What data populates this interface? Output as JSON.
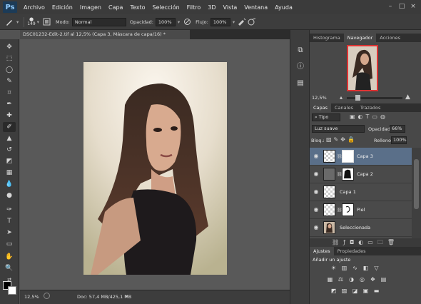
{
  "app": {
    "logo": "Ps"
  },
  "menu": [
    "Archivo",
    "Edición",
    "Imagen",
    "Capa",
    "Texto",
    "Selección",
    "Filtro",
    "3D",
    "Vista",
    "Ventana",
    "Ayuda"
  ],
  "window_controls": [
    "–",
    "□",
    "×"
  ],
  "options": {
    "brush_size": "149",
    "mode_label": "Modo:",
    "mode_value": "Normal",
    "opacity_label": "Opacidad:",
    "opacity_value": "100%",
    "flow_label": "Flujo:",
    "flow_value": "100%"
  },
  "document": {
    "tab_title": "DSC01232-Edit-2.tif al 12,5% (Capa 3, Máscara de capa/16) *",
    "zoom": "12,5%",
    "doc_info": "Doc: 57,4 MB/425,1 MB"
  },
  "navigator": {
    "tabs": [
      "Histograma",
      "Navegador",
      "Acciones"
    ],
    "active_tab": "Navegador",
    "zoom": "12,5%"
  },
  "layers_panel": {
    "tabs": [
      "Capas",
      "Canales",
      "Trazados"
    ],
    "active_tab": "Capas",
    "filter": "Tipo",
    "blend_mode": "Luz suave",
    "opacity_label": "Opacidad:",
    "opacity": "66%",
    "lock_label": "Bloq.:",
    "fill_label": "Relleno:",
    "fill": "100%",
    "layers": [
      {
        "name": "Capa 3",
        "selected": true
      },
      {
        "name": "Capa 2",
        "selected": false
      },
      {
        "name": "Capa 1",
        "selected": false
      },
      {
        "name": "Piel",
        "selected": false
      },
      {
        "name": "Seleccionada",
        "selected": false
      }
    ]
  },
  "adjustments": {
    "tabs": [
      "Ajustes",
      "Propiedades"
    ],
    "active_tab": "Ajustes",
    "heading": "Añadir un ajuste"
  },
  "colors": {
    "selection": "#5a6f89",
    "panel": "#484848",
    "canvas": "#595959"
  }
}
